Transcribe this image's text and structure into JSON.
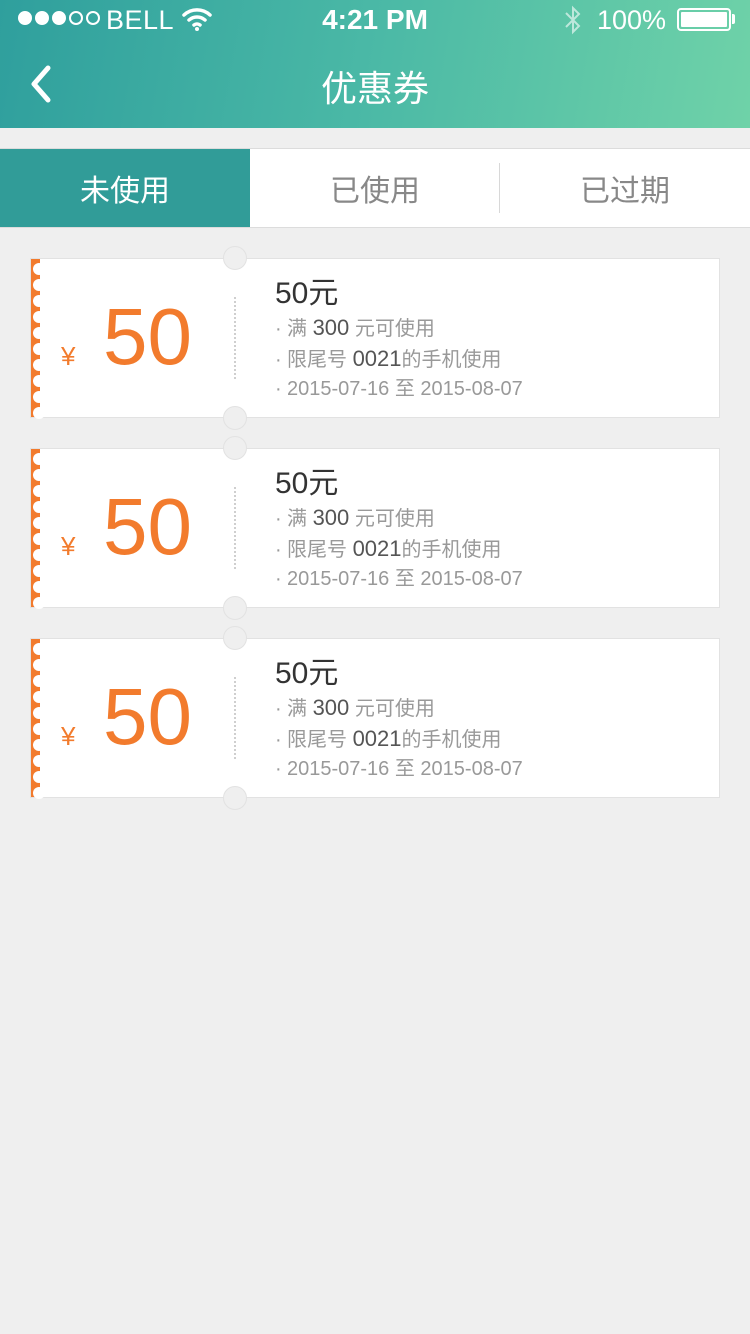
{
  "status_bar": {
    "carrier": "BELL",
    "time": "4:21 PM",
    "battery": "100%"
  },
  "header": {
    "title": "优惠券",
    "back_icon": "chevron-left-icon"
  },
  "tabs": [
    {
      "label": "未使用",
      "active": true
    },
    {
      "label": "已使用",
      "active": false
    },
    {
      "label": "已过期",
      "active": false
    }
  ],
  "coupons": [
    {
      "currency": "¥",
      "amount": "50",
      "title": "50元",
      "condition_prefix": "满 ",
      "condition_value": "300",
      "condition_suffix": " 元可使用",
      "phone_prefix": "限尾号 ",
      "phone_value": "0021",
      "phone_suffix": "的手机使用",
      "validity": "2015-07-16 至 2015-08-07"
    },
    {
      "currency": "¥",
      "amount": "50",
      "title": "50元",
      "condition_prefix": "满 ",
      "condition_value": "300",
      "condition_suffix": " 元可使用",
      "phone_prefix": "限尾号 ",
      "phone_value": "0021",
      "phone_suffix": "的手机使用",
      "validity": "2015-07-16 至 2015-08-07"
    },
    {
      "currency": "¥",
      "amount": "50",
      "title": "50元",
      "condition_prefix": "满 ",
      "condition_value": "300",
      "condition_suffix": " 元可使用",
      "phone_prefix": "限尾号 ",
      "phone_value": "0021",
      "phone_suffix": "的手机使用",
      "validity": "2015-07-16 至 2015-08-07"
    }
  ],
  "colors": {
    "header_start": "#2f9f9d",
    "header_end": "#6fd2a8",
    "active_tab": "#319c98",
    "accent": "#f27b2d",
    "background": "#efefef"
  }
}
